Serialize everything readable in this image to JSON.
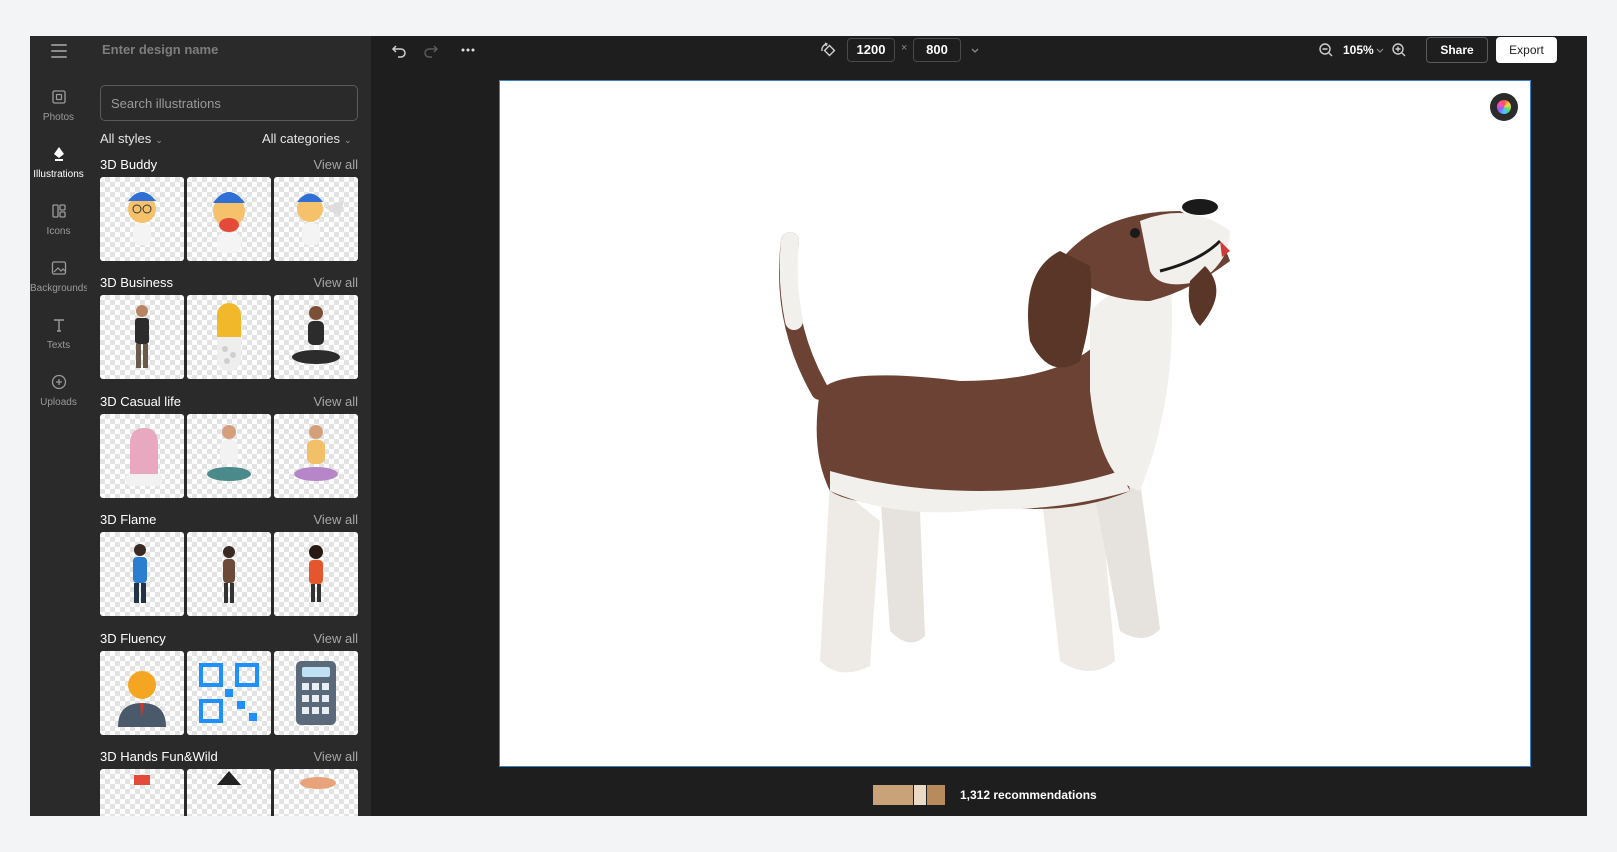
{
  "panel": {
    "design_name_placeholder": "Enter design name",
    "search_placeholder": "Search illustrations",
    "style_filter": "All styles",
    "category_filter": "All categories"
  },
  "rail": {
    "items": [
      {
        "label": "Photos",
        "icon": "photo-icon"
      },
      {
        "label": "Illustrations",
        "icon": "pen-nib-icon",
        "active": true
      },
      {
        "label": "Icons",
        "icon": "shapes-icon"
      },
      {
        "label": "Backgrounds",
        "icon": "image-icon"
      },
      {
        "label": "Texts",
        "icon": "text-icon"
      },
      {
        "label": "Uploads",
        "icon": "upload-icon"
      }
    ]
  },
  "sections": [
    {
      "title": "3D Buddy",
      "view_all": "View all"
    },
    {
      "title": "3D Business",
      "view_all": "View all"
    },
    {
      "title": "3D Casual life",
      "view_all": "View all"
    },
    {
      "title": "3D Flame",
      "view_all": "View all"
    },
    {
      "title": "3D Fluency",
      "view_all": "View all"
    },
    {
      "title": "3D Hands Fun&Wild",
      "view_all": "View all"
    }
  ],
  "toolbar": {
    "width": "1200",
    "height": "800",
    "times": "×",
    "zoom": "105%",
    "share": "Share",
    "export": "Export"
  },
  "footer": {
    "recommendations": "1,312 recommendations"
  },
  "colors": {
    "app_bg": "#1e1e1e",
    "panel_bg": "#2a2a2a",
    "canvas_border": "#3b82c4",
    "dog_brown": "#6b4233",
    "dog_white": "#f2f0ec"
  }
}
